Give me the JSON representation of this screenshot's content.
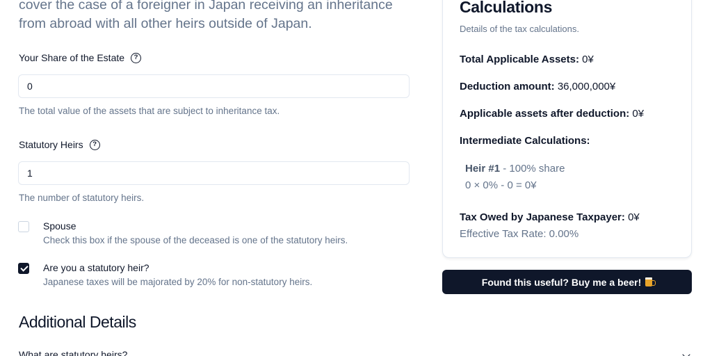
{
  "intro": {
    "line1": "cover the case of a foreigner in Japan receiving an inheritance",
    "line2": "from abroad with all other heirs outside of Japan."
  },
  "form": {
    "estate_share": {
      "label": "Your Share of the Estate",
      "value": "0",
      "hint": "The total value of the assets that are subject to inheritance tax."
    },
    "statutory_heirs": {
      "label": "Statutory Heirs",
      "value": "1",
      "hint": "The number of statutory heirs."
    },
    "spouse": {
      "label": "Spouse",
      "checked": false,
      "description": "Check this box if the spouse of the deceased is one of the statutory heirs."
    },
    "is_statutory_heir": {
      "label": "Are you a statutory heir?",
      "checked": true,
      "description": "Japanese taxes will be majorated by 20% for non-statutory heirs."
    }
  },
  "additional": {
    "title": "Additional Details",
    "items": [
      {
        "label": "What are statutory heirs?"
      }
    ]
  },
  "calculations": {
    "title": "Calculations",
    "subtitle": "Details of the tax calculations.",
    "total_assets_label": "Total Applicable Assets:",
    "total_assets_value": "0¥",
    "deduction_label": "Deduction amount:",
    "deduction_value": "36,000,000¥",
    "after_deduction_label": "Applicable assets after deduction:",
    "after_deduction_value": "0¥",
    "intermediate_label": "Intermediate Calculations:",
    "heirs": [
      {
        "name": "Heir #1",
        "share": "- 100% share",
        "formula": "0 × 0% - 0 = 0¥"
      }
    ],
    "tax_owed_label": "Tax Owed by Japanese Taxpayer:",
    "tax_owed_value": "0¥",
    "effective_rate": "Effective Tax Rate: 0.00%"
  },
  "beer_button": {
    "label": "Found this useful? Buy me a beer!",
    "icon": "beer-mug-icon"
  },
  "colors": {
    "primary": "#0f172a",
    "muted": "#64748b",
    "border": "#e2e8f0"
  }
}
